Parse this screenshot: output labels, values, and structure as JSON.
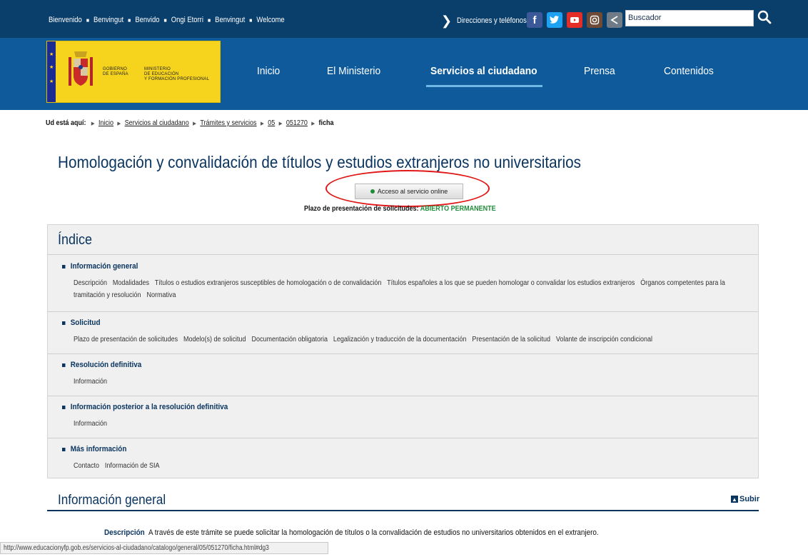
{
  "topbar": {
    "languages": [
      "Bienvenido",
      "Benvingut",
      "Benvido",
      "Ongi Etorri",
      "Benvingut",
      "Welcome"
    ],
    "directions_label": "Direcciones y teléfonos",
    "social_icons": [
      "facebook-icon",
      "twitter-icon",
      "youtube-icon",
      "instagram-icon",
      "share-icon"
    ],
    "search_placeholder": "Buscador"
  },
  "logo": {
    "gov_line1": "GOBIERNO",
    "gov_line2": "DE ESPAÑA",
    "min_line1": "MINISTERIO",
    "min_line2": "DE EDUCACIÓN",
    "min_line3": "Y FORMACIÓN PROFESIONAL"
  },
  "nav": {
    "items": [
      "Inicio",
      "El Ministerio",
      "Servicios al ciudadano",
      "Prensa",
      "Contenidos"
    ],
    "active": "Servicios al ciudadano"
  },
  "breadcrumb": {
    "label": "Ud está aquí:",
    "items": [
      "Inicio",
      "Servicios al ciudadano",
      "Trámites y servicios",
      "05",
      "051270"
    ],
    "current": "ficha"
  },
  "page": {
    "title": "Homologación y convalidación de títulos y estudios extranjeros no universitarios",
    "access_button": "Acceso al servicio online",
    "plazo_label": "Plazo de presentación de solicitudes:",
    "plazo_status": "ABIERTO PERMANENTE"
  },
  "index": {
    "title": "Índice",
    "sections": [
      {
        "title": "Información general",
        "links": [
          "Descripción",
          "Modalidades",
          "Títulos o estudios extranjeros susceptibles de homologación o de convalidación",
          "Títulos españoles a los que se pueden homologar o convalidar los estudios extranjeros",
          "Órganos competentes para la tramitación y resolución",
          "Normativa"
        ]
      },
      {
        "title": "Solicitud",
        "links": [
          "Plazo de presentación de solicitudes",
          "Modelo(s) de solicitud",
          "Documentación obligatoria",
          "Legalización y traducción de la documentación",
          "Presentación de la solicitud",
          "Volante de inscripción condicional"
        ]
      },
      {
        "title": "Resolución definitiva",
        "links": [
          "Información"
        ]
      },
      {
        "title": "Información posterior a la resolución definitiva",
        "links": [
          "Información"
        ]
      },
      {
        "title": "Más información",
        "links": [
          "Contacto",
          "Información de SIA"
        ]
      }
    ]
  },
  "info_section": {
    "title": "Información general",
    "subir": "Subir",
    "desc_label": "Descripción",
    "desc_text": "A través de este trámite se puede solicitar la homologación de títulos o la convalidación de estudios no universitarios obtenidos en el extranjero."
  },
  "statusbar": {
    "url": "http://www.educacionyfp.gob.es/servicios-al-ciudadano/catalogo/general/05/051270/ficha.html#dg3"
  }
}
